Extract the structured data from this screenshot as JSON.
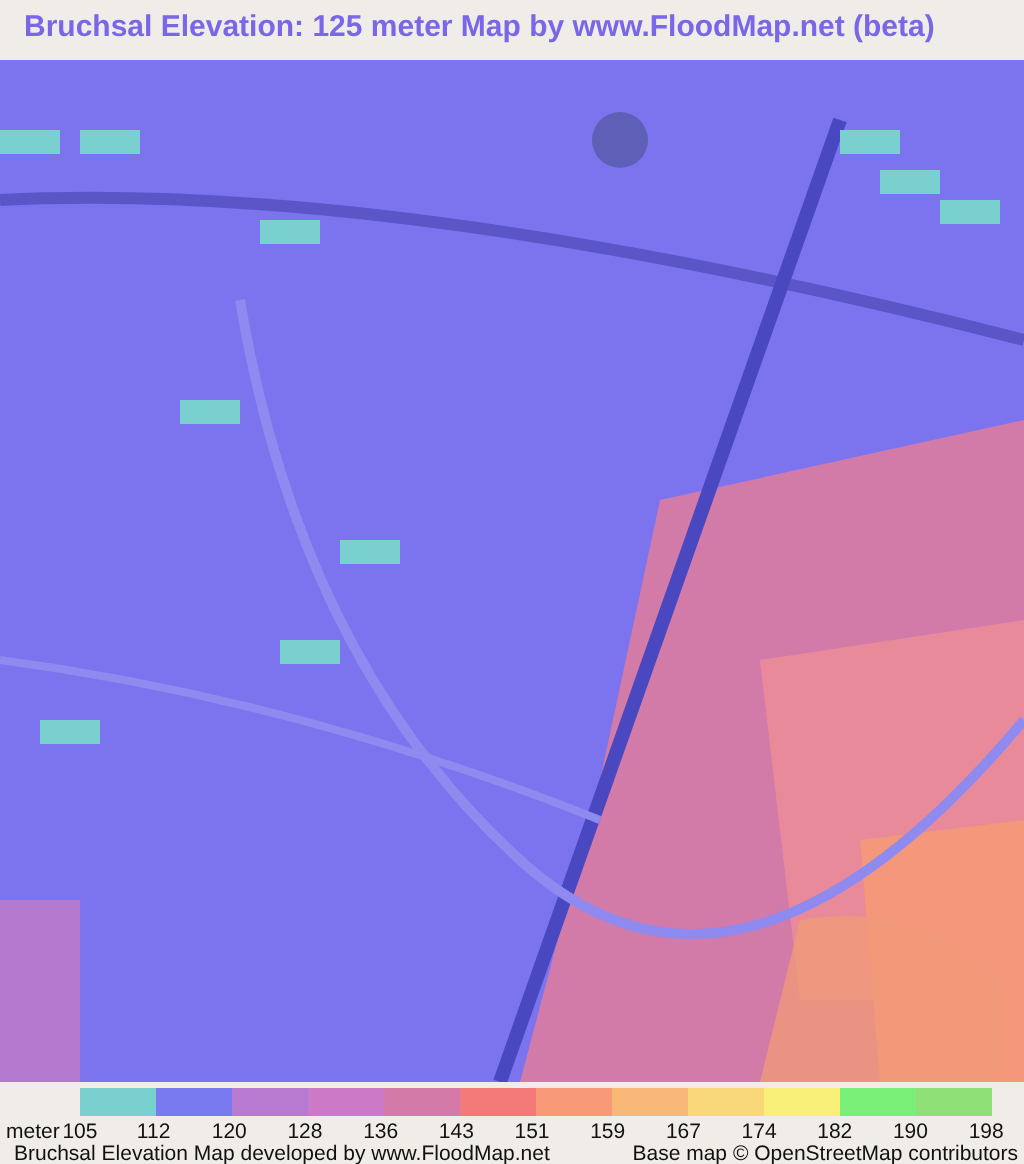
{
  "title": "Bruchsal Elevation: 125 meter Map by www.FloodMap.net (beta)",
  "legend": {
    "unit": "meter",
    "labels": [
      "105",
      "112",
      "120",
      "128",
      "136",
      "143",
      "151",
      "159",
      "167",
      "174",
      "182",
      "190",
      "198"
    ],
    "steps": [
      {
        "color": "#7acfcf"
      },
      {
        "color": "#7a7af0"
      },
      {
        "color": "#b87ad0"
      },
      {
        "color": "#cc7ac8"
      },
      {
        "color": "#d47aa8"
      },
      {
        "color": "#f47a7a"
      },
      {
        "color": "#f89a78"
      },
      {
        "color": "#f8b878"
      },
      {
        "color": "#f8d878"
      },
      {
        "color": "#f8f078"
      },
      {
        "color": "#7af078"
      },
      {
        "color": "#90e078"
      }
    ]
  },
  "footer": {
    "credit": "Bruchsal Elevation Map developed by www.FloodMap.net",
    "attribution": "Base map © OpenStreetMap contributors"
  }
}
